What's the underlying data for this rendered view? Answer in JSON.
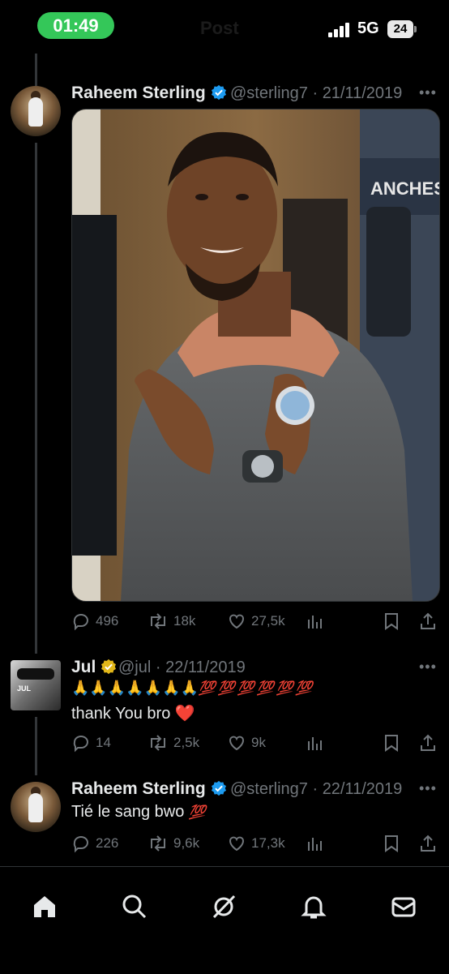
{
  "status_bar": {
    "time": "01:49",
    "ghost_title": "Post",
    "network": "5G",
    "battery": "24"
  },
  "tweets": [
    {
      "name": "Raheem Sterling",
      "handle": "@sterling7",
      "date": "21/11/2019",
      "replies": "496",
      "retweets": "18k",
      "likes": "27,5k"
    },
    {
      "name": "Jul",
      "handle": "@jul",
      "date": "22/11/2019",
      "emoji_line": "🙏🙏🙏🙏🙏🙏🙏",
      "hundreds": "💯 💯 💯 💯 💯 💯",
      "text": "thank You bro",
      "heart": "❤️",
      "avatar_text": "JUL",
      "replies": "14",
      "retweets": "2,5k",
      "likes": "9k"
    },
    {
      "name": "Raheem Sterling",
      "handle": "@sterling7",
      "date": "22/11/2019",
      "text": "Tié le sang bwo",
      "hundred": "💯",
      "replies": "226",
      "retweets": "9,6k",
      "likes": "17,3k"
    }
  ],
  "photo": {
    "banner_text": "ANCHEST"
  },
  "icons": {
    "tabs": [
      "home-icon",
      "search-icon",
      "grok-icon",
      "notifications-icon",
      "messages-icon"
    ]
  },
  "colors": {
    "accent_blue": "#1d9bf0",
    "verified_gold": "#e2b719",
    "status_green": "#34c759"
  }
}
